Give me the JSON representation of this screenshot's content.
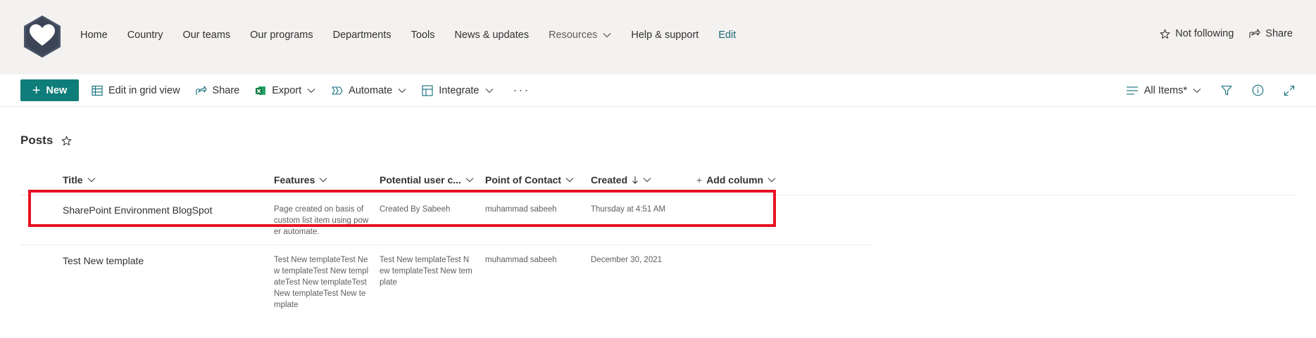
{
  "nav": {
    "items": [
      {
        "label": "Home",
        "style": "normal"
      },
      {
        "label": "Country",
        "style": "normal"
      },
      {
        "label": "Our teams",
        "style": "normal"
      },
      {
        "label": "Our programs",
        "style": "normal"
      },
      {
        "label": "Departments",
        "style": "normal"
      },
      {
        "label": "Tools",
        "style": "normal"
      },
      {
        "label": "News & updates",
        "style": "normal"
      },
      {
        "label": "Resources",
        "style": "muted",
        "dropdown": true
      },
      {
        "label": "Help & support",
        "style": "normal"
      },
      {
        "label": "Edit",
        "style": "edit"
      }
    ],
    "not_following": "Not following",
    "share": "Share"
  },
  "toolbar": {
    "new_label": "New",
    "edit_grid": "Edit in grid view",
    "share": "Share",
    "export": "Export",
    "automate": "Automate",
    "integrate": "Integrate",
    "more": "···",
    "view_name": "All Items*"
  },
  "list": {
    "title": "Posts",
    "columns": {
      "title": "Title",
      "features": "Features",
      "potential": "Potential user c...",
      "contact": "Point of Contact",
      "created": "Created",
      "add": "Add column"
    },
    "rows": [
      {
        "title": "SharePoint Environment BlogSpot",
        "features": "Page created on basis of custom list item using power automate.",
        "potential": "Created By Sabeeh",
        "contact": "muhammad sabeeh",
        "created": "Thursday at 4:51 AM"
      },
      {
        "title": "Test New template",
        "features": "Test New templateTest New templateTest New templateTest New templateTest New templateTest New template",
        "potential": "Test New templateTest New templateTest New template",
        "contact": "muhammad sabeeh",
        "created": "December 30, 2021"
      }
    ]
  },
  "colors": {
    "accent": "#0f7d79",
    "highlight_border": "#e81123",
    "nav_bg": "#f3f2f1"
  }
}
